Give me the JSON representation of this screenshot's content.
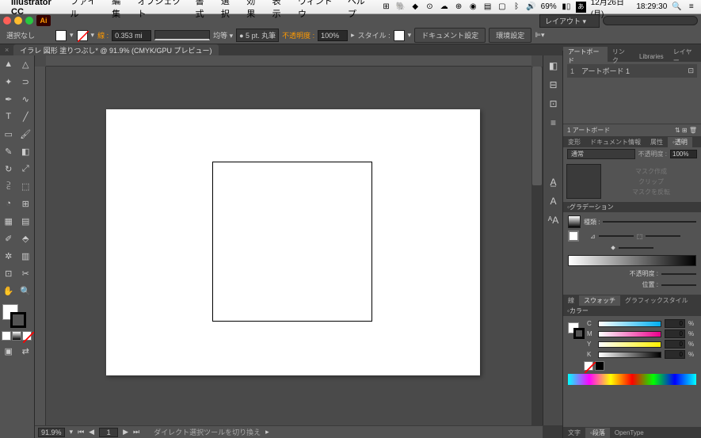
{
  "menubar": {
    "app": "Illustrator CC",
    "items": [
      "ファイル",
      "編集",
      "オブジェクト",
      "書式",
      "選択",
      "効果",
      "表示",
      "ウィンドウ",
      "ヘルプ"
    ],
    "battery": "69%",
    "date": "12月26日(月)",
    "time": "18:29:30"
  },
  "topbar": {
    "ai": "Ai",
    "layout": "レイアウト ▾"
  },
  "control": {
    "selection": "選択なし",
    "stroke_label": "線 :",
    "stroke_width": "0.353 mi",
    "uniform": "均等 ▾",
    "brush": "● 5 pt. 丸筆",
    "opacity_label": "不透明度 :",
    "opacity": "100%",
    "style_label": "スタイル :",
    "doc_setup": "ドキュメント設定",
    "prefs": "環境設定"
  },
  "doc": {
    "tab": "イラレ 図形 塗りつぶし* @ 91.9% (CMYK/GPU プレビュー)"
  },
  "status": {
    "zoom": "91.9%",
    "artboard_nav": "1",
    "tool_hint": "ダイレクト選択ツールを切り換え"
  },
  "panels": {
    "artboards": {
      "tabs": [
        "アートボード",
        "リンク",
        "Libraries",
        "レイヤー"
      ],
      "row_num": "1",
      "row_name": "アートボード 1",
      "footer": "1 アートボード"
    },
    "trans": {
      "tabs": [
        "変形",
        "ドキュメント情報",
        "属性",
        "◦透明"
      ],
      "mode": "通常",
      "opacity_label": "不透明度 :",
      "opacity": "100%",
      "mask_make": "マスク作成",
      "mask_clip": "クリップ",
      "mask_invert": "マスクを反転"
    },
    "grad": {
      "title": "◦グラデーション",
      "type_label": "種類 :",
      "angle_icon": "⊿",
      "ratio_icon": "⬚",
      "opacity_label": "不透明度 :",
      "pos_label": "位置 :"
    },
    "stroke_swatch": {
      "tabs": [
        "線",
        "スウォッチ",
        "グラフィックスタイル"
      ]
    },
    "color": {
      "title": "◦カラー",
      "c": {
        "label": "C",
        "val": "0",
        "pct": "%"
      },
      "m": {
        "label": "M",
        "val": "0",
        "pct": "%"
      },
      "y": {
        "label": "Y",
        "val": "0",
        "pct": "%"
      },
      "k": {
        "label": "K",
        "val": "0",
        "pct": "%"
      }
    },
    "bottom_tabs": [
      "文字",
      "◦段落",
      "OpenType"
    ]
  }
}
